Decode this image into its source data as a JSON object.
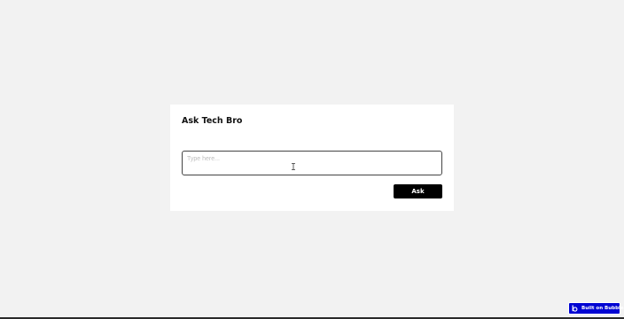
{
  "card": {
    "title": "Ask Tech Bro",
    "input": {
      "placeholder": "Type here...",
      "value": ""
    },
    "ask_button_label": "Ask"
  },
  "badge": {
    "label": "Built on Bubble",
    "icon": "bubble-logo-icon",
    "color": "#0205d3"
  },
  "colors": {
    "page_background": "#f2f2f2",
    "card_background": "#ffffff",
    "button_background": "#000000",
    "button_text": "#ffffff"
  }
}
